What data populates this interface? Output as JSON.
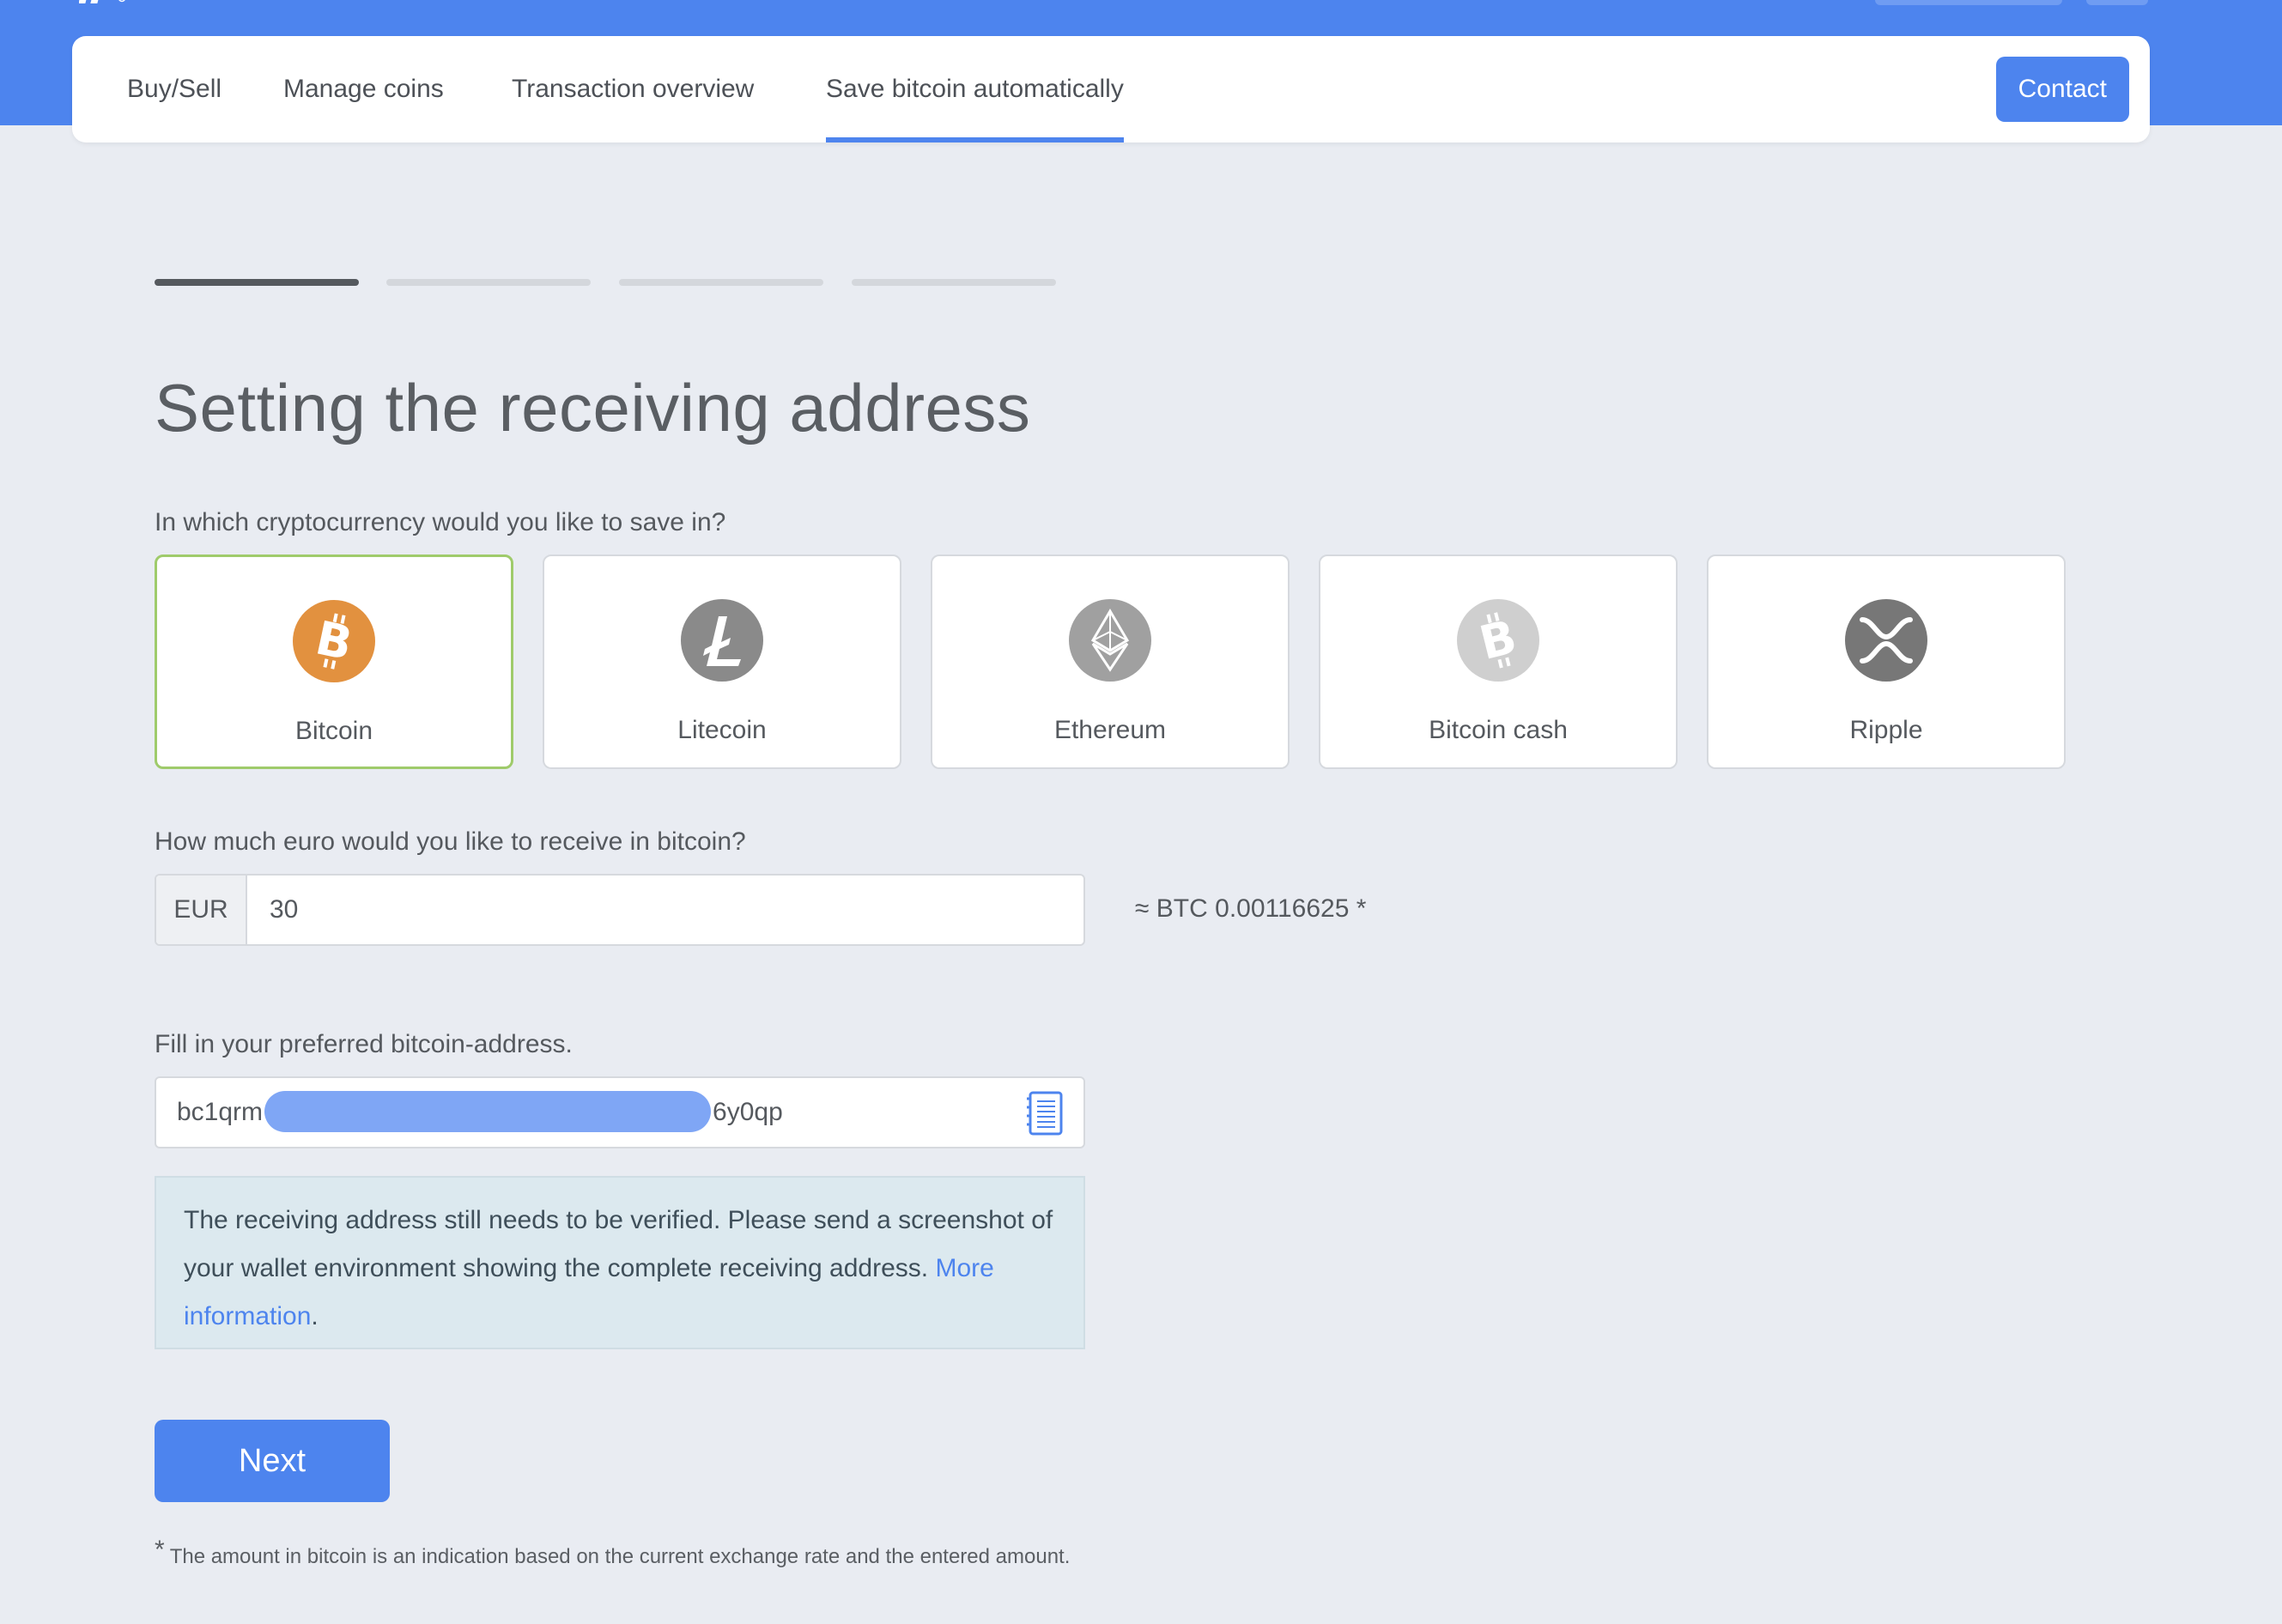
{
  "nav": {
    "items": [
      {
        "label": "Buy/Sell"
      },
      {
        "label": "Manage coins"
      },
      {
        "label": "Transaction overview"
      },
      {
        "label": "Save bitcoin automatically",
        "active": true
      }
    ],
    "contact_label": "Contact"
  },
  "progress": {
    "total_steps": 4,
    "current_step": 1
  },
  "page": {
    "title": "Setting the receiving address"
  },
  "crypto": {
    "question": "In which cryptocurrency would you like to save in?",
    "selected": "Bitcoin",
    "options": [
      {
        "name": "Bitcoin",
        "icon": "bitcoin-icon",
        "color": "#e2913f"
      },
      {
        "name": "Litecoin",
        "icon": "litecoin-icon",
        "color": "#8a8a8a"
      },
      {
        "name": "Ethereum",
        "icon": "ethereum-icon",
        "color": "#a0a0a0"
      },
      {
        "name": "Bitcoin cash",
        "icon": "bitcoin-cash-icon",
        "color": "#cfcfcf"
      },
      {
        "name": "Ripple",
        "icon": "ripple-icon",
        "color": "#777777"
      }
    ]
  },
  "amount": {
    "question": "How much euro would you like to receive in bitcoin?",
    "currency": "EUR",
    "value": "30",
    "estimate": "≈ BTC 0.00116625 *"
  },
  "address": {
    "question": "Fill in your preferred bitcoin-address.",
    "value_start": "bc1qrm",
    "value_end": "6y0qp"
  },
  "notice": {
    "text": "The receiving address still needs to be verified. Please send a screenshot of your wallet environment showing the complete receiving address.",
    "link": "More information",
    "end": "."
  },
  "actions": {
    "next_label": "Next"
  },
  "footnote": {
    "mark": "*",
    "text": "The amount in bitcoin is an indication based on the current exchange rate and the entered amount."
  },
  "colors": {
    "brand_blue": "#4d84ee",
    "selected_border": "#9fcb6b",
    "background": "#e9ecf2"
  }
}
